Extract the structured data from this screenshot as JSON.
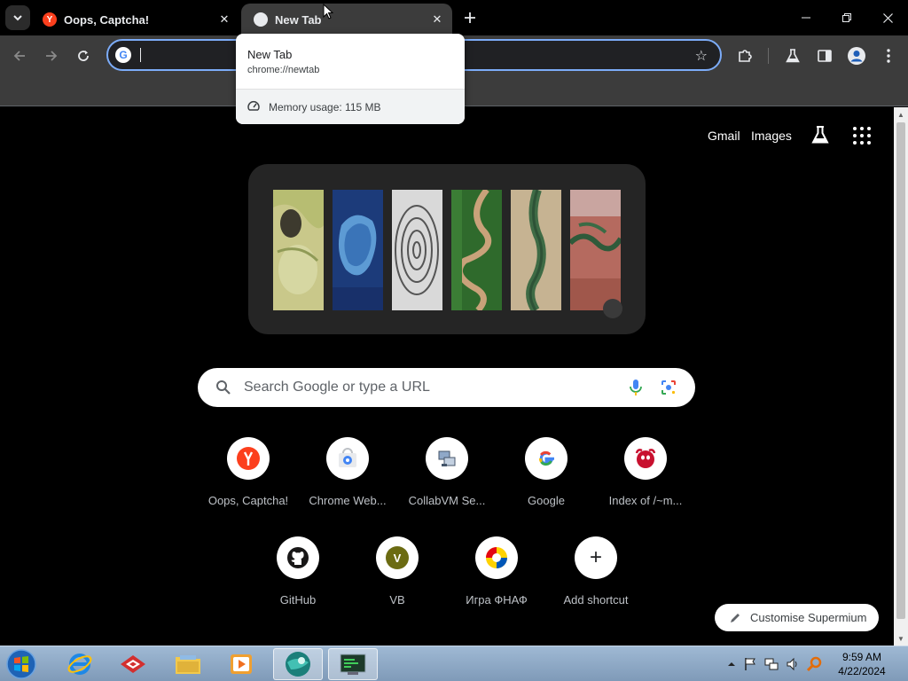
{
  "tabs": [
    {
      "title": "Oops, Captcha!",
      "favicon": "yandex-icon",
      "active": false
    },
    {
      "title": "New Tab",
      "favicon": "globe-icon",
      "active": true
    }
  ],
  "window_controls": {
    "minimize": "minimize-icon",
    "restore": "restore-icon",
    "close": "close-icon"
  },
  "toolbar": {
    "back": "arrow-left-icon",
    "forward": "arrow-right-icon",
    "reload": "reload-icon",
    "omnibox_value": "",
    "extensions": "puzzle-icon",
    "labs": "flask-icon",
    "side_panel": "side-panel-icon",
    "profile": "profile-icon",
    "menu": "kebab-icon"
  },
  "hover_card": {
    "title": "New Tab",
    "url": "chrome://newtab",
    "memory": "Memory usage: 115 MB"
  },
  "ntp": {
    "links": [
      "Gmail",
      "Images"
    ],
    "search_placeholder": "Search Google or type a URL",
    "shortcuts": [
      {
        "label": "Oops, Captcha!",
        "icon": "yandex-icon"
      },
      {
        "label": "Chrome Web...",
        "icon": "chrome-webstore-icon"
      },
      {
        "label": "CollabVM Se...",
        "icon": "collabvm-icon"
      },
      {
        "label": "Google",
        "icon": "google-icon"
      },
      {
        "label": "Index of /~m...",
        "icon": "freebsd-icon"
      },
      {
        "label": "GitHub",
        "icon": "github-icon"
      },
      {
        "label": "VB",
        "icon": "letter-v-icon",
        "letter": "V"
      },
      {
        "label": "Игра ФНАФ",
        "icon": "fnaf-game-icon"
      },
      {
        "label": "Add shortcut",
        "icon": "plus-icon",
        "glyph": "+"
      }
    ],
    "customise_label": "Customise Supermium"
  },
  "taskbar": {
    "apps": [
      "internet-explorer-icon",
      "tool-icon",
      "file-explorer-icon",
      "media-player-icon",
      "supermium-icon",
      "terminal-icon"
    ],
    "clock_time": "9:59 AM",
    "clock_date": "4/22/2024"
  },
  "colors": {
    "toolbar_bg": "#3c3c3c",
    "omnibox_focus": "#7cacf8",
    "page_bg": "#000000",
    "taskbar": "#8aa6c4"
  }
}
